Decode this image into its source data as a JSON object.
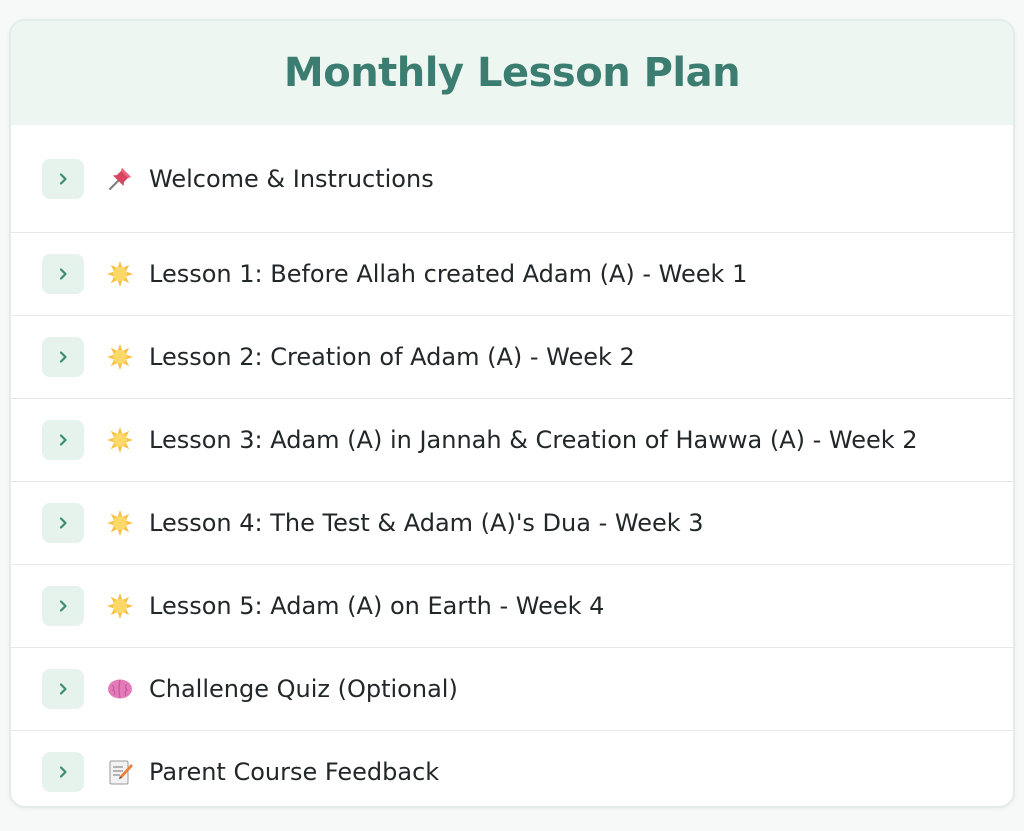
{
  "page": {
    "title": "Monthly Lesson Plan"
  },
  "colors": {
    "accent": "#3c7d71",
    "header_bg": "#edf6f1",
    "chevron_bg": "#e5f3ec",
    "chevron": "#3c8f6c"
  },
  "lessons": [
    {
      "label": "Welcome & Instructions",
      "icon": "pushpin-icon"
    },
    {
      "label": "Lesson 1: Before Allah created Adam (A) - Week 1",
      "icon": "sun-icon"
    },
    {
      "label": "Lesson 2: Creation of Adam (A) - Week 2",
      "icon": "sun-icon"
    },
    {
      "label": "Lesson 3: Adam (A) in Jannah & Creation of Hawwa (A) - Week 2",
      "icon": "sun-icon"
    },
    {
      "label": "Lesson 4: The Test & Adam (A)'s Dua - Week 3",
      "icon": "sun-icon"
    },
    {
      "label": "Lesson 5: Adam (A) on Earth - Week 4",
      "icon": "sun-icon"
    },
    {
      "label": "Challenge Quiz (Optional)",
      "icon": "brain-icon"
    },
    {
      "label": "Parent Course Feedback",
      "icon": "memo-icon"
    }
  ]
}
